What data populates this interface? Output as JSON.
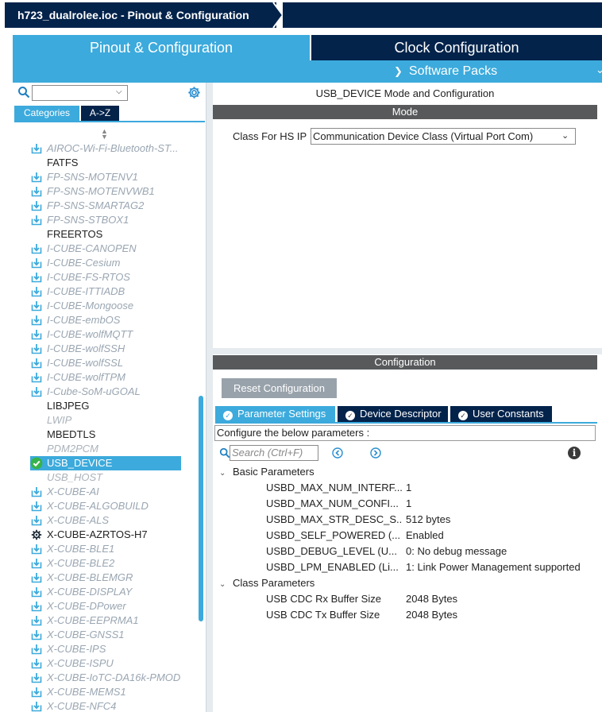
{
  "window": {
    "title": "h723_dualrolee.ioc - Pinout & Configuration"
  },
  "tabs": {
    "pinout": "Pinout & Configuration",
    "clock": "Clock Configuration",
    "software_packs": "Software Packs"
  },
  "left": {
    "search_value": "",
    "categories_tab": "Categories",
    "az_tab": "A->Z",
    "items": [
      {
        "label": "AIROC-Wi-Fi-Bluetooth-ST...",
        "kind": "dl"
      },
      {
        "label": "FATFS",
        "kind": "plain"
      },
      {
        "label": "FP-SNS-MOTENV1",
        "kind": "dl"
      },
      {
        "label": "FP-SNS-MOTENVWB1",
        "kind": "dl"
      },
      {
        "label": "FP-SNS-SMARTAG2",
        "kind": "dl"
      },
      {
        "label": "FP-SNS-STBOX1",
        "kind": "dl"
      },
      {
        "label": "FREERTOS",
        "kind": "plain"
      },
      {
        "label": "I-CUBE-CANOPEN",
        "kind": "dl"
      },
      {
        "label": "I-CUBE-Cesium",
        "kind": "dl"
      },
      {
        "label": "I-CUBE-FS-RTOS",
        "kind": "dl"
      },
      {
        "label": "I-CUBE-ITTIADB",
        "kind": "dl"
      },
      {
        "label": "I-CUBE-Mongoose",
        "kind": "dl"
      },
      {
        "label": "I-CUBE-embOS",
        "kind": "dl"
      },
      {
        "label": "I-CUBE-wolfMQTT",
        "kind": "dl"
      },
      {
        "label": "I-CUBE-wolfSSH",
        "kind": "dl"
      },
      {
        "label": "I-CUBE-wolfSSL",
        "kind": "dl"
      },
      {
        "label": "I-CUBE-wolfTPM",
        "kind": "dl"
      },
      {
        "label": "I-Cube-SoM-uGOAL",
        "kind": "dl"
      },
      {
        "label": "LIBJPEG",
        "kind": "plain"
      },
      {
        "label": "LWIP",
        "kind": "gray"
      },
      {
        "label": "MBEDTLS",
        "kind": "plain"
      },
      {
        "label": "PDM2PCM",
        "kind": "gray"
      },
      {
        "label": "USB_DEVICE",
        "kind": "selected"
      },
      {
        "label": "USB_HOST",
        "kind": "gray"
      },
      {
        "label": "X-CUBE-AI",
        "kind": "dl"
      },
      {
        "label": "X-CUBE-ALGOBUILD",
        "kind": "dl"
      },
      {
        "label": "X-CUBE-ALS",
        "kind": "dl"
      },
      {
        "label": "X-CUBE-AZRTOS-H7",
        "kind": "gear"
      },
      {
        "label": "X-CUBE-BLE1",
        "kind": "dl"
      },
      {
        "label": "X-CUBE-BLE2",
        "kind": "dl"
      },
      {
        "label": "X-CUBE-BLEMGR",
        "kind": "dl"
      },
      {
        "label": "X-CUBE-DISPLAY",
        "kind": "dl"
      },
      {
        "label": "X-CUBE-DPower",
        "kind": "dl"
      },
      {
        "label": "X-CUBE-EEPRMA1",
        "kind": "dl"
      },
      {
        "label": "X-CUBE-GNSS1",
        "kind": "dl"
      },
      {
        "label": "X-CUBE-IPS",
        "kind": "dl"
      },
      {
        "label": "X-CUBE-ISPU",
        "kind": "dl"
      },
      {
        "label": "X-CUBE-IoTC-DA16k-PMOD",
        "kind": "dl"
      },
      {
        "label": "X-CUBE-MEMS1",
        "kind": "dl"
      },
      {
        "label": "X-CUBE-NFC4",
        "kind": "dl"
      }
    ]
  },
  "mode": {
    "title": "USB_DEVICE Mode and Configuration",
    "header": "Mode",
    "class_label": "Class For HS IP",
    "class_value": "Communication Device Class (Virtual Port Com)"
  },
  "config": {
    "header": "Configuration",
    "reset_button": "Reset Configuration",
    "tab_params": "Parameter Settings",
    "tab_devdesc": "Device Descriptor",
    "tab_userconst": "User Constants",
    "configure_text": "Configure the below parameters :",
    "search_placeholder": "Search (Ctrl+F)",
    "groups": [
      {
        "name": "Basic Parameters",
        "params": [
          {
            "name": "USBD_MAX_NUM_INTERF...",
            "value": "1"
          },
          {
            "name": "USBD_MAX_NUM_CONFI...",
            "value": "1"
          },
          {
            "name": "USBD_MAX_STR_DESC_S...",
            "value": "512 bytes"
          },
          {
            "name": "USBD_SELF_POWERED (...",
            "value": "Enabled"
          },
          {
            "name": "USBD_DEBUG_LEVEL (U...",
            "value": "0: No debug message"
          },
          {
            "name": "USBD_LPM_ENABLED (Li...",
            "value": "1: Link Power Management supported"
          }
        ]
      },
      {
        "name": "Class Parameters",
        "params": [
          {
            "name": "USB CDC Rx Buffer Size",
            "value": "2048 Bytes"
          },
          {
            "name": "USB CDC Tx Buffer Size",
            "value": "2048 Bytes"
          }
        ]
      }
    ]
  },
  "colors": {
    "navy": "#03234b",
    "accent": "#3caadc",
    "header_gray": "#57595b",
    "download_icon": "#3caadc",
    "check_green": "#37b34a"
  },
  "icons": {
    "download": "download-icon",
    "gear": "gear-icon",
    "check": "check-circle-icon",
    "search": "search-icon",
    "info": "info-icon"
  }
}
